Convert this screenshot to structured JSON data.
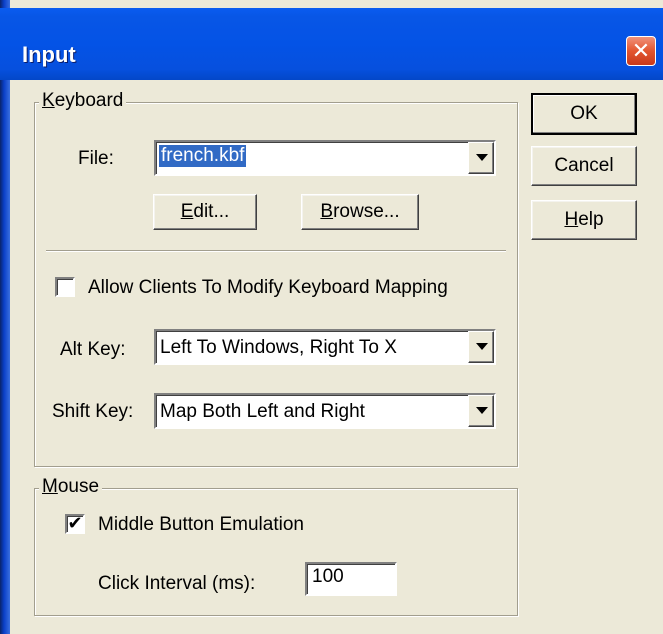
{
  "window": {
    "title": "Input",
    "close_glyph": "✕"
  },
  "keyboard": {
    "group_label_accel": "K",
    "group_label_rest": "eyboard",
    "file_label": "File:",
    "file_value": "french.kbf",
    "edit_button_accel": "E",
    "edit_button_rest": "dit...",
    "browse_button_accel": "B",
    "browse_button_rest": "rowse...",
    "allow_modify_label": "Allow Clients To Modify Keyboard Mapping",
    "allow_modify_checked": false,
    "alt_key_label": "Alt Key:",
    "alt_key_value": "Left To Windows, Right To X",
    "shift_key_label": "Shift Key:",
    "shift_key_value": "Map Both Left and Right"
  },
  "mouse": {
    "group_label_accel": "M",
    "group_label_rest": "ouse",
    "middle_button_label": "Middle Button Emulation",
    "middle_button_checked": true,
    "check_glyph": "✔",
    "click_interval_label": "Click Interval (ms):",
    "click_interval_value": "100"
  },
  "buttons": {
    "ok": "OK",
    "cancel": "Cancel",
    "help_accel": "H",
    "help_rest": "elp"
  },
  "colors": {
    "titlebar": "#0453e6",
    "close": "#e3552f",
    "dialog_bg": "#ece9d8",
    "selection": "#316ac5"
  },
  "icons": {
    "close": "close-icon",
    "dropdown": "chevron-down-icon",
    "check": "checkmark-icon"
  }
}
